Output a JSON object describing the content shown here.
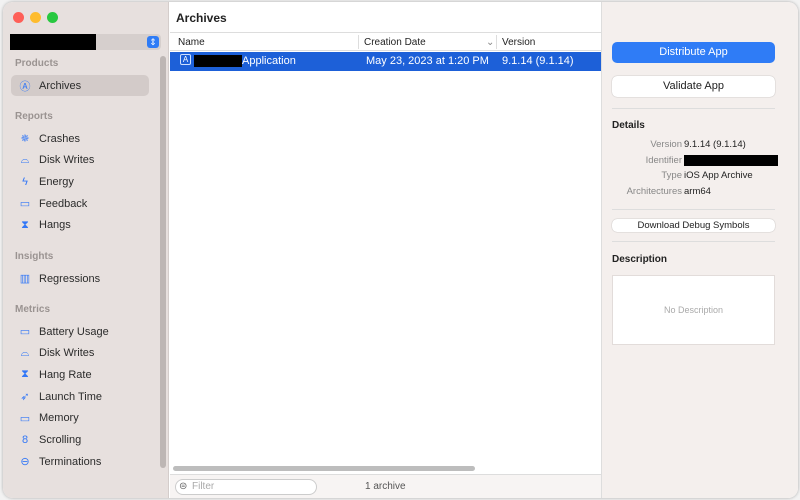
{
  "sidebar": {
    "sections": [
      {
        "title": "Products",
        "items": [
          {
            "label": "Archives",
            "icon": "app-store-icon",
            "selected": true
          }
        ]
      },
      {
        "title": "Reports",
        "items": [
          {
            "label": "Crashes",
            "icon": "crash-burst-icon"
          },
          {
            "label": "Disk Writes",
            "icon": "disk-icon"
          },
          {
            "label": "Energy",
            "icon": "bolt-icon"
          },
          {
            "label": "Feedback",
            "icon": "speech-bubble-icon"
          },
          {
            "label": "Hangs",
            "icon": "hourglass-icon"
          }
        ]
      },
      {
        "title": "Insights",
        "items": [
          {
            "label": "Regressions",
            "icon": "bars-icon"
          }
        ]
      },
      {
        "title": "Metrics",
        "items": [
          {
            "label": "Battery Usage",
            "icon": "battery-icon"
          },
          {
            "label": "Disk Writes",
            "icon": "disk-icon"
          },
          {
            "label": "Hang Rate",
            "icon": "hourglass-icon"
          },
          {
            "label": "Launch Time",
            "icon": "rocket-icon"
          },
          {
            "label": "Memory",
            "icon": "memory-icon"
          },
          {
            "label": "Scrolling",
            "icon": "scroll-icon"
          },
          {
            "label": "Terminations",
            "icon": "minus-circle-icon"
          }
        ]
      }
    ]
  },
  "main": {
    "title": "Archives",
    "columns": [
      "Name",
      "Creation Date",
      "Version"
    ],
    "rows": [
      {
        "name": "Application",
        "date": "May 23, 2023 at 1:20 PM",
        "version": "9.1.14 (9.1.14)"
      }
    ],
    "filter_placeholder": "Filter",
    "count": "1 archive"
  },
  "inspector": {
    "distribute": "Distribute App",
    "validate": "Validate App",
    "details_title": "Details",
    "details": [
      {
        "k": "Version",
        "v": "9.1.14 (9.1.14)"
      },
      {
        "k": "Identifier",
        "v": ""
      },
      {
        "k": "Type",
        "v": "iOS App Archive"
      },
      {
        "k": "Architectures",
        "v": "arm64"
      }
    ],
    "download": "Download Debug Symbols",
    "description_title": "Description",
    "description": "No Description"
  },
  "colors": {
    "accent": "#2f7cf6",
    "selection": "#1d60d8"
  }
}
